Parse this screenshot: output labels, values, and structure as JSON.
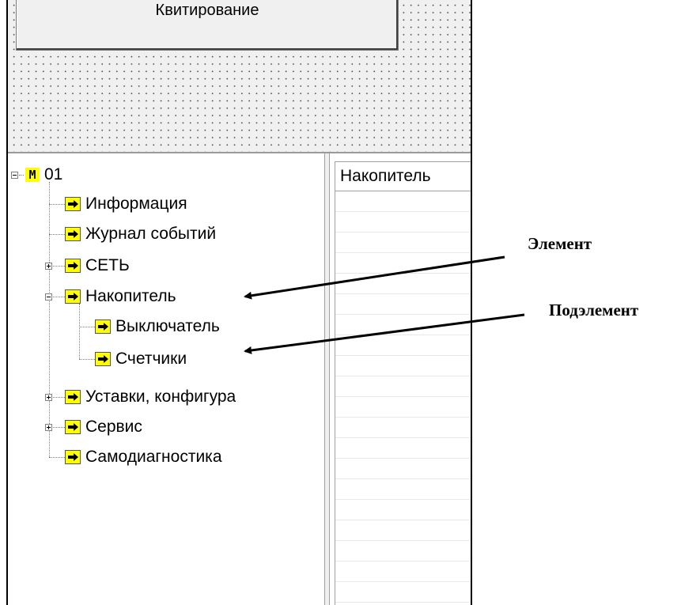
{
  "toolbar": {
    "ack_button_label": "Квитирование"
  },
  "tree": {
    "root": {
      "label": "01",
      "icon": "m-icon"
    },
    "items": [
      {
        "label": "Информация",
        "expander": "none"
      },
      {
        "label": "Журнал событий",
        "expander": "none"
      },
      {
        "label": "СЕТЬ",
        "expander": "plus"
      },
      {
        "label": "Накопитель",
        "expander": "minus",
        "children": [
          {
            "label": "Выключатель"
          },
          {
            "label": "Счетчики"
          }
        ]
      },
      {
        "label": "Уставки, конфигура",
        "expander": "plus"
      },
      {
        "label": "Сервис",
        "expander": "plus"
      },
      {
        "label": "Самодиагностика",
        "expander": "none"
      }
    ]
  },
  "grid": {
    "column_header": "Накопитель"
  },
  "annotations": {
    "element": "Элемент",
    "subelement": "Подэлемент"
  },
  "colors": {
    "icon_background": "#ffff00",
    "panel_background": "#f0f0f0"
  }
}
